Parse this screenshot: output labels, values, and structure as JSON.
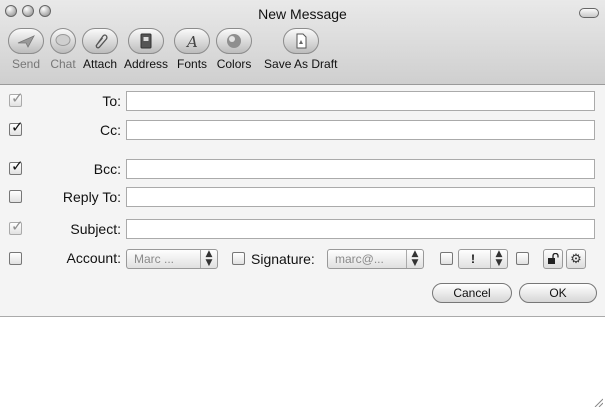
{
  "window": {
    "title": "New Message"
  },
  "toolbar": {
    "buttons": [
      {
        "label": "Send",
        "enabled": false,
        "icon": "send-icon"
      },
      {
        "label": "Chat",
        "enabled": false,
        "icon": "chat-icon"
      },
      {
        "label": "Attach",
        "enabled": true,
        "icon": "paperclip-icon"
      },
      {
        "label": "Address",
        "enabled": true,
        "icon": "address-book-icon"
      },
      {
        "label": "Fonts",
        "enabled": true,
        "icon": "fonts-icon"
      },
      {
        "label": "Colors",
        "enabled": true,
        "icon": "color-wheel-icon"
      },
      {
        "label": "Save As Draft",
        "enabled": true,
        "icon": "save-draft-icon"
      }
    ]
  },
  "fields": {
    "to": {
      "label": "To:",
      "value": "",
      "checked": true,
      "dim": true
    },
    "cc": {
      "label": "Cc:",
      "value": "",
      "checked": true,
      "dim": false
    },
    "bcc": {
      "label": "Bcc:",
      "value": "",
      "checked": true,
      "dim": false
    },
    "reply_to": {
      "label": "Reply To:",
      "value": "",
      "checked": false,
      "dim": false
    },
    "subject": {
      "label": "Subject:",
      "value": "",
      "checked": true,
      "dim": true
    }
  },
  "account_row": {
    "account_label": "Account:",
    "account_value": "Marc ...",
    "signature_label": "Signature:",
    "signature_value": "marc@...",
    "priority_value": "!"
  },
  "buttons": {
    "cancel": "Cancel",
    "ok": "OK"
  },
  "message_body": ""
}
